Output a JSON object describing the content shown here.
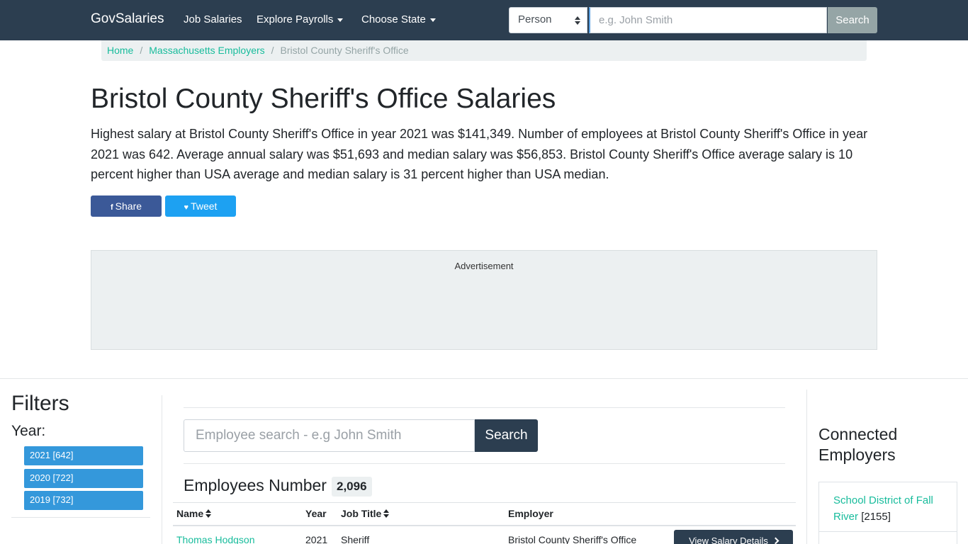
{
  "navbar": {
    "brand": "GovSalaries",
    "items": [
      {
        "label": "Job Salaries"
      },
      {
        "label": "Explore Payrolls"
      },
      {
        "label": "Choose State"
      }
    ],
    "search_type": "Person",
    "search_placeholder": "e.g. John Smith",
    "search_button": "Search"
  },
  "breadcrumb": {
    "home": "Home",
    "parent": "Massachusetts Employers",
    "current": "Bristol County Sheriff's Office"
  },
  "page": {
    "title": "Bristol County Sheriff's Office Salaries",
    "intro": "Highest salary at Bristol County Sheriff's Office in year 2021 was $141,349. Number of employees at Bristol County Sheriff's Office in year 2021 was 642. Average annual salary was $51,693 and median salary was $56,853. Bristol County Sheriff's Office average salary is 10 percent higher than USA average and median salary is 31 percent higher than USA median.",
    "share_label": "Share",
    "tweet_label": "Tweet",
    "share_icon_glyph": "f",
    "tweet_icon_glyph": "♥"
  },
  "ad": {
    "label": "Advertisement"
  },
  "filters": {
    "title": "Filters",
    "year_label": "Year:",
    "years": [
      {
        "label": "2021 [642]"
      },
      {
        "label": "2020 [722]"
      },
      {
        "label": "2019 [732]"
      }
    ]
  },
  "main": {
    "search_placeholder": "Employee search - e.g John Smith",
    "search_button": "Search",
    "employees_label": "Employees Number",
    "employees_count": "2,096",
    "table": {
      "headers": {
        "name": "Name",
        "year": "Year",
        "job_title": "Job Title",
        "employer": "Employer"
      },
      "rows": [
        {
          "name": "Thomas Hodgson",
          "year": "2021",
          "job_title": "Sheriff",
          "employer": "Bristol County Sheriff's Office",
          "action": "View Salary Details"
        }
      ]
    }
  },
  "sidebar_right": {
    "title": "Connected Employers",
    "employers": [
      {
        "name": "School District of Fall River",
        "count": "[2155]"
      }
    ]
  },
  "colors": {
    "navbar": "#2c3e50",
    "link": "#18bc9c",
    "pill": "#3498db",
    "facebook": "#3b5998",
    "twitter": "#1da1f2"
  }
}
